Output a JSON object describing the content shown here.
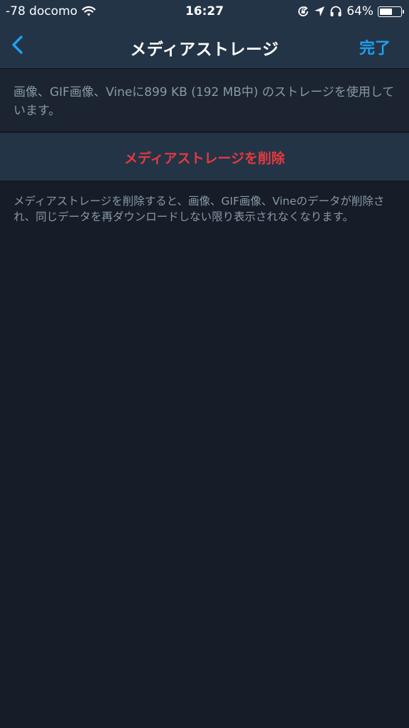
{
  "status_bar": {
    "carrier": "-78 docomo",
    "time": "16:27",
    "battery_percent_text": "64%",
    "battery_level": 0.64,
    "icons": [
      "wifi-icon",
      "orientation-lock-icon",
      "location-arrow-icon",
      "headphones-icon",
      "battery-icon"
    ]
  },
  "nav": {
    "title": "メディアストレージ",
    "back_icon": "chevron-left-icon",
    "done_label": "完了"
  },
  "storage_info": {
    "text": "画像、GIF画像、Vineに899 KB (192 MB中) のストレージを使用しています。"
  },
  "actions": {
    "delete_label": "メディアストレージを削除"
  },
  "footer": {
    "note": "メディアストレージを削除すると、画像、GIF画像、Vineのデータが削除され、同じデータを再ダウンロードしない限り表示されなくなります。"
  },
  "colors": {
    "background": "#161d28",
    "bar_background": "#243447",
    "accent_blue": "#1da1f2",
    "destructive_red": "#e8393f",
    "secondary_text": "#8899a6"
  }
}
